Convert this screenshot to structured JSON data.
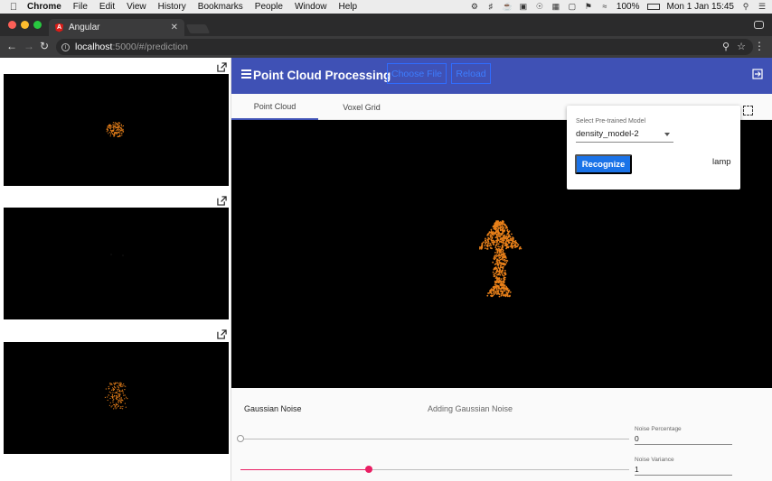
{
  "menubar": {
    "app": "Chrome",
    "items": [
      "File",
      "Edit",
      "View",
      "History",
      "Bookmarks",
      "People",
      "Window",
      "Help"
    ],
    "battery": "100%",
    "clock": "Mon 1 Jan  15:45"
  },
  "browser": {
    "tab_title": "Angular",
    "url_host": "localhost",
    "url_rest": ":5000/#/prediction"
  },
  "app": {
    "title": "Point Cloud Processing",
    "choose_file_label": "Choose File",
    "reload_label": "Reload",
    "tabs": [
      {
        "label": "Point Cloud",
        "active": true
      },
      {
        "label": "Voxel Grid",
        "active": false
      }
    ]
  },
  "model_card": {
    "select_label": "Select Pre-trained Model",
    "selected_model": "density_model-2",
    "recognize_label": "Recognize",
    "result": "lamp"
  },
  "noise": {
    "title": "Gaussian Noise",
    "description": "Adding Gaussian Noise",
    "percentage_label": "Noise Percentage",
    "percentage_value": "0",
    "variance_label": "Noise Variance",
    "variance_value": "1",
    "percentage_slider_level": 0,
    "variance_slider_level": 0.33
  },
  "colors": {
    "appbar": "#3f51b5",
    "accent": "#e91e63",
    "primary_button": "#1a73e8",
    "points": "#e8801a"
  }
}
